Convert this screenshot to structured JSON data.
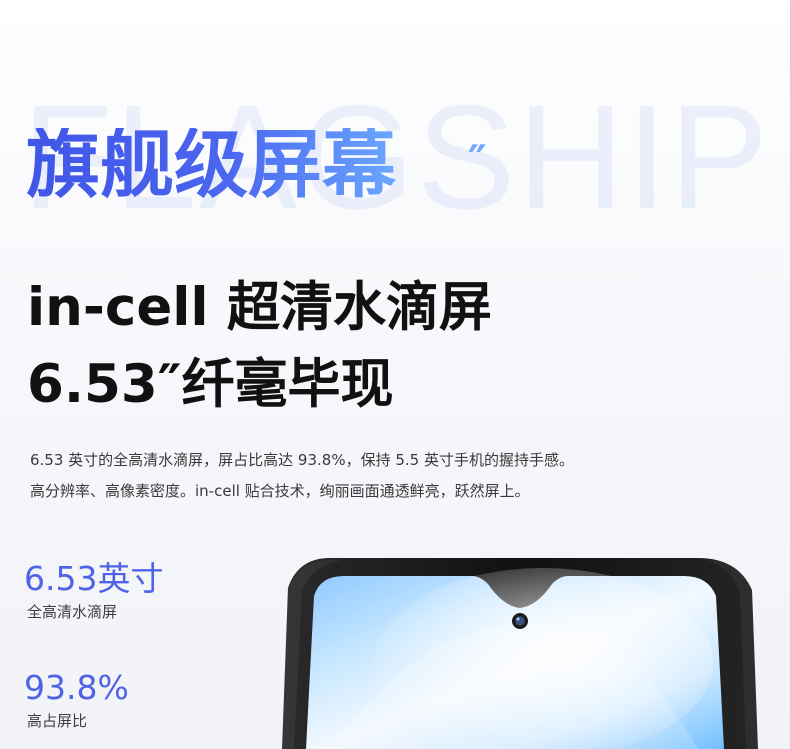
{
  "background_word": "FLAGSHIP",
  "title": "旗舰级屏幕",
  "title_quote": "″",
  "headline_line1": "in-cell 超清水滴屏",
  "headline_line2": "6.53″纤毫毕现",
  "description_line1": "6.53 英寸的全高清水滴屏，屏占比高达 93.8%，保持 5.5 英寸手机的握持手感。",
  "description_line2": "高分辨率、高像素密度。in-cell 贴合技术，绚丽画面通透鲜亮，跃然屏上。",
  "stats": [
    {
      "value": "6.53英寸",
      "label": "全高清水滴屏"
    },
    {
      "value": "93.8%",
      "label": "高占屏比"
    }
  ],
  "colors": {
    "accent_blue": "#4e63e8",
    "light_blue": "#6aa7ff",
    "text_dark": "#111111",
    "text_gray": "#3a3a3a",
    "phone_frame": "#161616"
  },
  "icons": {
    "phone_camera": "front-camera-icon"
  }
}
